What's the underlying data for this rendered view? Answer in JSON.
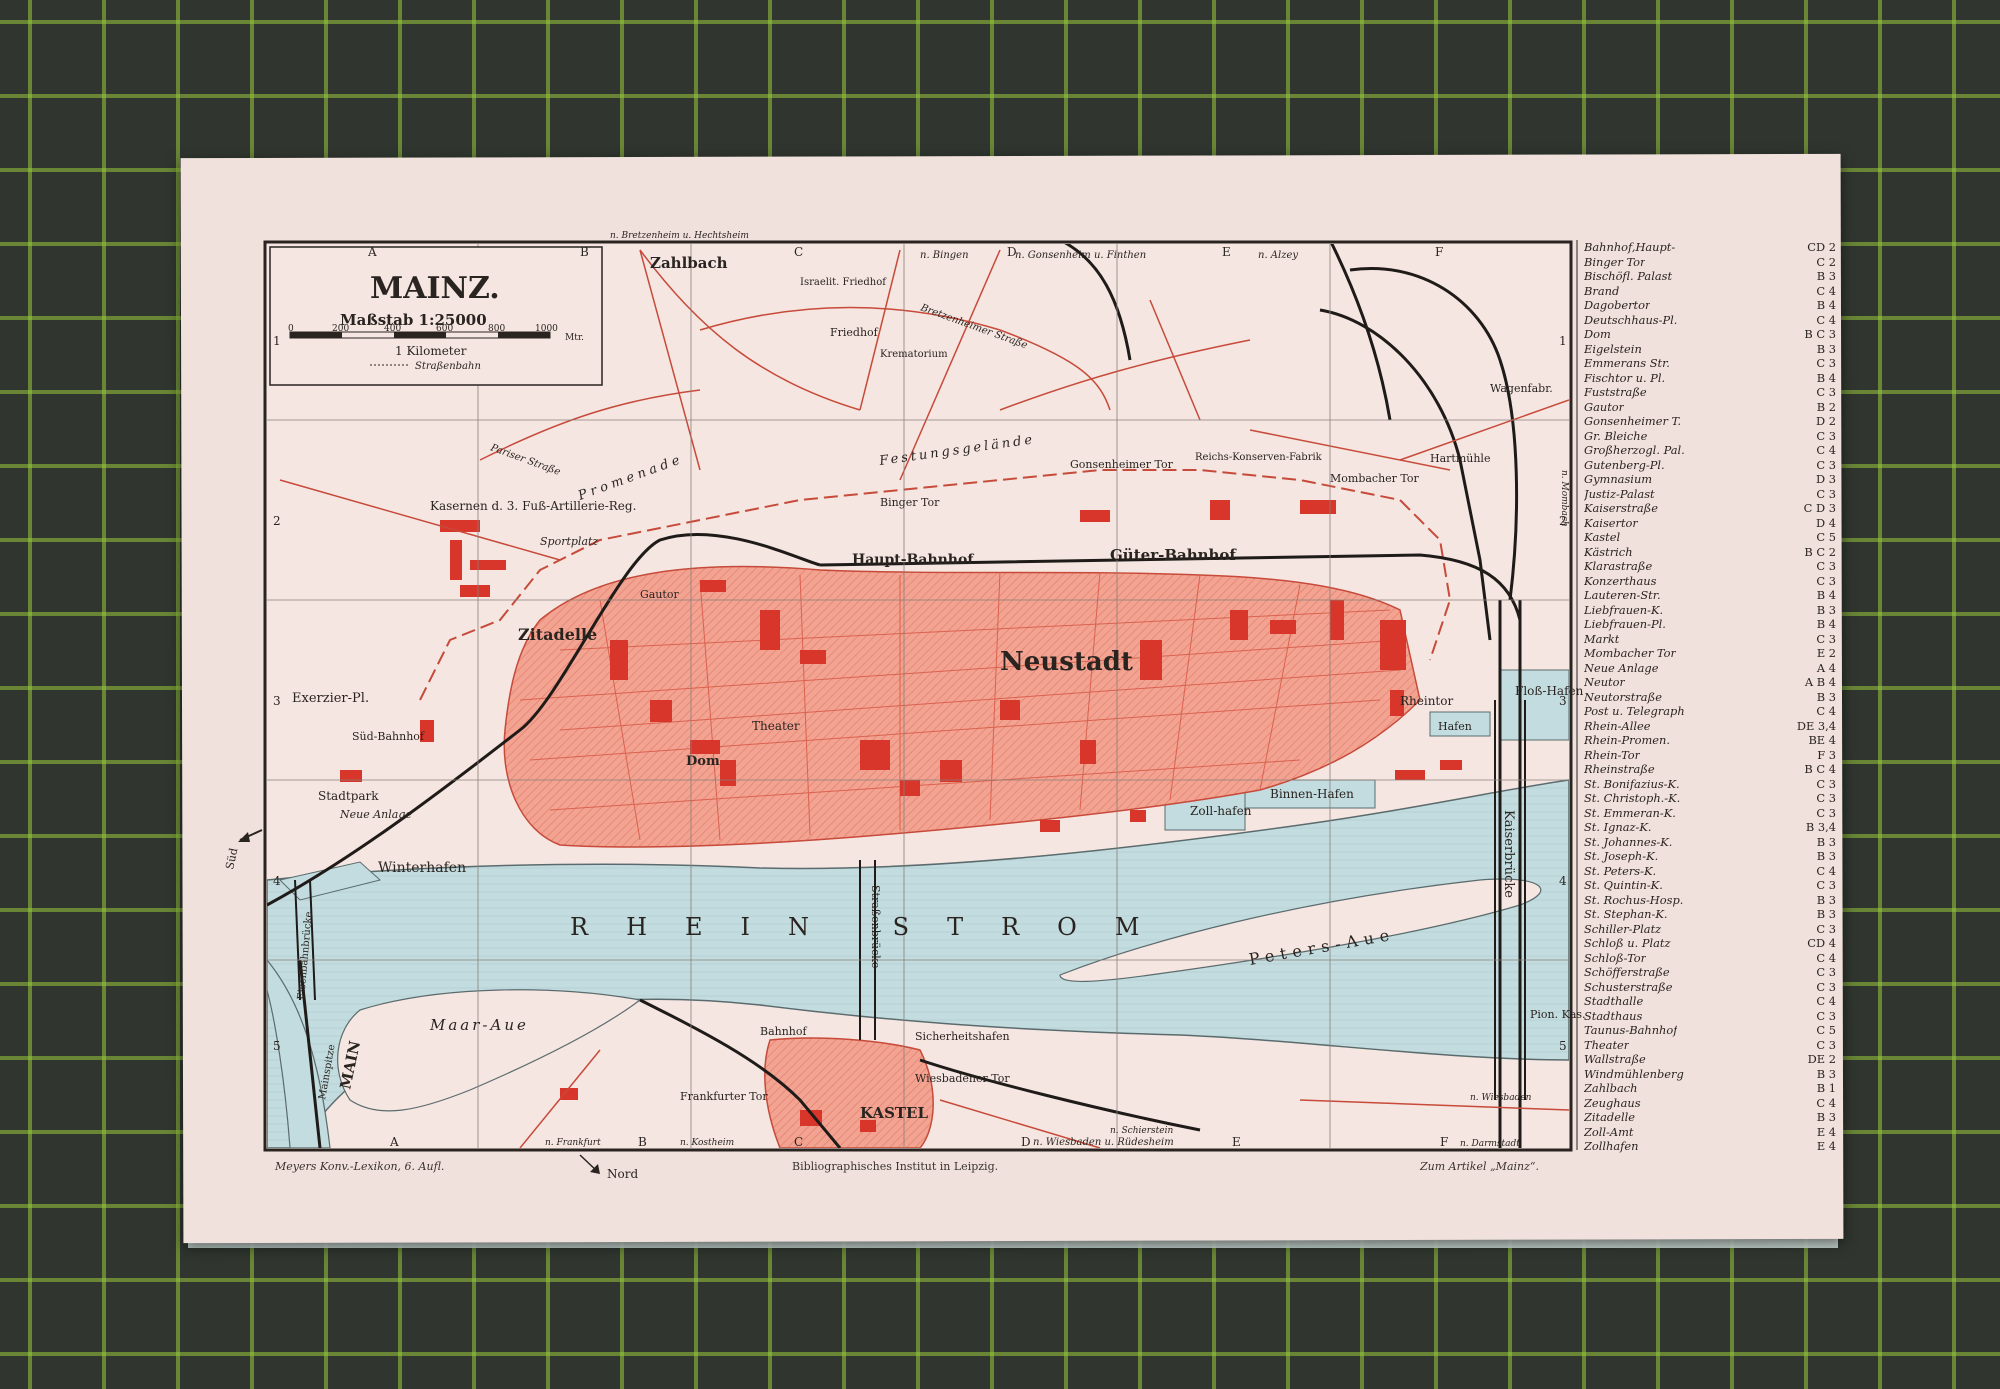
{
  "map": {
    "title": "MAINZ.",
    "scale_label": "Maßstab 1:25000",
    "scale_ticks": [
      "0",
      "200",
      "400",
      "600",
      "800",
      "1000",
      "Mtr."
    ],
    "scale_unit": "1 Kilometer",
    "legend_tram": "Straßenbahn",
    "grid_columns": [
      "A",
      "B",
      "C",
      "D",
      "E",
      "F"
    ],
    "grid_rows": [
      "1",
      "2",
      "3",
      "4",
      "5"
    ],
    "compass_south": "Süd",
    "compass_north": "Nord",
    "colors": {
      "paper": "#f1e1dc",
      "built_area": "#f09a88",
      "buildings": "#d8362b",
      "water": "#bfd9dc",
      "frame": "#2a2420"
    },
    "labels": {
      "road_top_1": "n. Bretzenheim u. Hechtsheim",
      "zahlbach": "Zahlbach",
      "road_bingen": "n. Bingen",
      "road_gonsenheim": "n. Gonsenheim u. Finthen",
      "road_alzey": "n. Alzey",
      "israel_friedhof": "Israelit. Friedhof",
      "friedhof": "Friedhof",
      "krematorium": "Krematorium",
      "kasernen": "Kasernen d. 3. Fuß-Artillerie-Reg.",
      "sportplatz": "Sportplatz",
      "zitadelle": "Zitadelle",
      "exerzier": "Exerzier-Pl.",
      "sued_bahnhof": "Süd-Bahnhof",
      "stadtpark": "Stadtpark",
      "neue_anlage": "Neue Anlage",
      "winterhafen": "Winterhafen",
      "haupt_bahnhof": "Haupt-Bahnhof",
      "gueter_bahnhof": "Güter-Bahnhof",
      "neustadt": "Neustadt",
      "gautor": "Gautor",
      "dom": "Dom",
      "theater": "Theater",
      "binger_tor": "Binger Tor",
      "gonsenheimer_tor": "Gonsenheimer Tor",
      "mombacher_tor": "Mombacher Tor",
      "hartmuehle": "Hartmühle",
      "rheintor": "Rheintor",
      "zollhafen": "Zoll-hafen",
      "binnenhafen": "Binnen-Hafen",
      "flosshafen": "Floß-Hafen",
      "hafen": "Hafen",
      "rhein_strom": "RHEIN STROM",
      "peters_aue": "Peters-Aue",
      "maar_aue": "Maar-Aue",
      "main": "MAIN",
      "mainspitze": "Mainspitze",
      "kaiserbruecke": "Kaiserbrücke",
      "strassenbruecke": "Straßenbrücke",
      "eisenbahnbruecke": "Eisenbahnbrücke",
      "sicherheitshafen": "Sicherheitshafen",
      "kastel": "KASTEL",
      "frankfurter_tor": "Frankfurter Tor",
      "wiesbadener_tor": "Wiesbadener Tor",
      "bahnhof": "Bahnhof",
      "road_frankfurt": "n. Frankfurt",
      "road_kostheim": "n. Kostheim",
      "road_wiesbaden": "n. Wiesbaden u. Rüdesheim",
      "road_schierstein": "n. Schierstein",
      "road_wiesbaden_right": "n. Wiesbaden",
      "road_darmstadt": "n. Darmstadt",
      "pion_kas": "Pion. Kas.",
      "wagenfabr": "Wagenfabr.",
      "reichs_konserven": "Reichs-Konserven-Fabrik",
      "zitadelle_weg": "Pariser Straße",
      "promenade": "Promenade",
      "festungsgelaende": "Festungsgelände",
      "bretzenheimer": "Bretzenheimer Straße",
      "mombacher_chaussee": "n. Mombach"
    }
  },
  "index": [
    {
      "n": "Bahnhof,Haupt-",
      "c": "CD 2"
    },
    {
      "n": "Binger Tor",
      "c": "C 2"
    },
    {
      "n": "Bischöfl. Palast",
      "c": "B 3"
    },
    {
      "n": "Brand",
      "c": "C 4"
    },
    {
      "n": "Dagobertor",
      "c": "B 4"
    },
    {
      "n": "Deutschhaus-Pl.",
      "c": "C 4"
    },
    {
      "n": "Dom",
      "c": "B C 3"
    },
    {
      "n": "Eigelstein",
      "c": "B 3"
    },
    {
      "n": "Emmerans Str.",
      "c": "C 3"
    },
    {
      "n": "Fischtor u. Pl.",
      "c": "B 4"
    },
    {
      "n": "Fuststraße",
      "c": "C 3"
    },
    {
      "n": "Gautor",
      "c": "B 2"
    },
    {
      "n": "Gonsenheimer T.",
      "c": "D 2"
    },
    {
      "n": "Gr. Bleiche",
      "c": "C 3"
    },
    {
      "n": "Großherzogl. Pal.",
      "c": "C 4"
    },
    {
      "n": "Gutenberg-Pl.",
      "c": "C 3"
    },
    {
      "n": "Gymnasium",
      "c": "D 3"
    },
    {
      "n": "Justiz-Palast",
      "c": "C 3"
    },
    {
      "n": "Kaiserstraße",
      "c": "C D 3"
    },
    {
      "n": "Kaisertor",
      "c": "D 4"
    },
    {
      "n": "Kastel",
      "c": "C 5"
    },
    {
      "n": "Kästrich",
      "c": "B C 2"
    },
    {
      "n": "Klarastraße",
      "c": "C 3"
    },
    {
      "n": "Konzerthaus",
      "c": "C 3"
    },
    {
      "n": "Lauteren-Str.",
      "c": "B 4"
    },
    {
      "n": "Liebfrauen-K.",
      "c": "B 3"
    },
    {
      "n": "Liebfrauen-Pl.",
      "c": "B 4"
    },
    {
      "n": "Markt",
      "c": "C 3"
    },
    {
      "n": "Mombacher Tor",
      "c": "E 2"
    },
    {
      "n": "Neue Anlage",
      "c": "A 4"
    },
    {
      "n": "Neutor",
      "c": "A B 4"
    },
    {
      "n": "Neutorstraße",
      "c": "B 3"
    },
    {
      "n": "Post u. Telegraph",
      "c": "C 4"
    },
    {
      "n": "Rhein-Allee",
      "c": "DE 3,4"
    },
    {
      "n": "Rhein-Promen.",
      "c": "BE 4"
    },
    {
      "n": "Rhein-Tor",
      "c": "F 3"
    },
    {
      "n": "Rheinstraße",
      "c": "B C 4"
    },
    {
      "n": "St. Bonifazius-K.",
      "c": "C 3"
    },
    {
      "n": "St. Christoph.-K.",
      "c": "C 3"
    },
    {
      "n": "St. Emmeran-K.",
      "c": "C 3"
    },
    {
      "n": "St. Ignaz-K.",
      "c": "B 3,4"
    },
    {
      "n": "St. Johannes-K.",
      "c": "B 3"
    },
    {
      "n": "St. Joseph-K.",
      "c": "B 3"
    },
    {
      "n": "St. Peters-K.",
      "c": "C 4"
    },
    {
      "n": "St. Quintin-K.",
      "c": "C 3"
    },
    {
      "n": "St. Rochus-Hosp.",
      "c": "B 3"
    },
    {
      "n": "St. Stephan-K.",
      "c": "B 3"
    },
    {
      "n": "Schiller-Platz",
      "c": "C 3"
    },
    {
      "n": "Schloß u. Platz",
      "c": "CD 4"
    },
    {
      "n": "Schloß-Tor",
      "c": "C 4"
    },
    {
      "n": "Schöfferstraße",
      "c": "C 3"
    },
    {
      "n": "Schusterstraße",
      "c": "C 3"
    },
    {
      "n": "Stadthalle",
      "c": "C 4"
    },
    {
      "n": "Stadthaus",
      "c": "C 3"
    },
    {
      "n": "Taunus-Bahnhof",
      "c": "C 5"
    },
    {
      "n": "Theater",
      "c": "C 3"
    },
    {
      "n": "Wallstraße",
      "c": "DE 2"
    },
    {
      "n": "Windmühlenberg",
      "c": "B 3"
    },
    {
      "n": "Zahlbach",
      "c": "B 1"
    },
    {
      "n": "Zeughaus",
      "c": "C 4"
    },
    {
      "n": "Zitadelle",
      "c": "B 3"
    },
    {
      "n": "Zoll-Amt",
      "c": "E 4"
    },
    {
      "n": "Zollhafen",
      "c": "E 4"
    }
  ],
  "footer": {
    "left": "Meyers Konv.-Lexikon, 6. Aufl.",
    "center": "Bibliographisches Institut in Leipzig.",
    "right": "Zum Artikel „Mainz“."
  }
}
